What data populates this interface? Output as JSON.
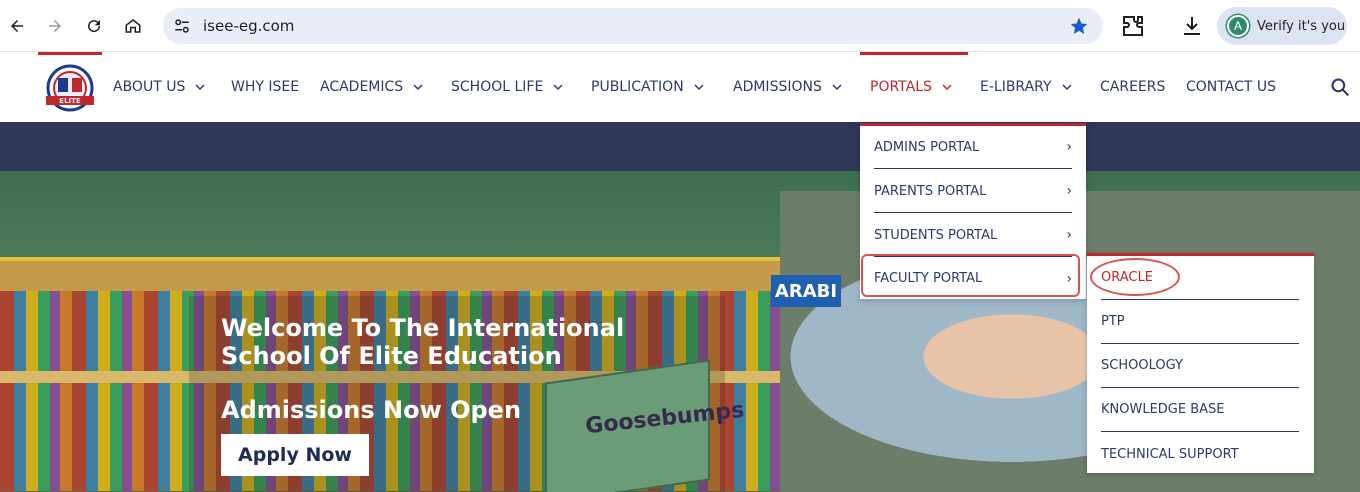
{
  "browser": {
    "url": "isee-eg.com",
    "profile_button": "Verify it's you",
    "profile_initial": "A",
    "icons": [
      "back-icon",
      "forward-icon",
      "reload-icon",
      "home-icon",
      "site-settings-icon",
      "bookmark-star-icon",
      "extensions-icon",
      "download-icon"
    ]
  },
  "nav": {
    "items": [
      {
        "label": "ABOUT US",
        "has_dropdown": true
      },
      {
        "label": "WHY ISEE",
        "has_dropdown": false
      },
      {
        "label": "ACADEMICS",
        "has_dropdown": true
      },
      {
        "label": "SCHOOL LIFE",
        "has_dropdown": true
      },
      {
        "label": "PUBLICATION",
        "has_dropdown": true
      },
      {
        "label": "ADMISSIONS",
        "has_dropdown": true
      },
      {
        "label": "PORTALS",
        "has_dropdown": true,
        "active": true
      },
      {
        "label": "E-LIBRARY",
        "has_dropdown": true
      },
      {
        "label": "CAREERS",
        "has_dropdown": false
      },
      {
        "label": "CONTACT US",
        "has_dropdown": false
      }
    ]
  },
  "portals_menu": {
    "items": [
      {
        "label": "ADMINS PORTAL"
      },
      {
        "label": "PARENTS PORTAL"
      },
      {
        "label": "STUDENTS PORTAL"
      },
      {
        "label": "FACULTY PORTAL",
        "highlighted": true
      }
    ]
  },
  "faculty_submenu": {
    "items": [
      {
        "label": "ORACLE",
        "highlighted": true
      },
      {
        "label": "PTP"
      },
      {
        "label": "SCHOOLOGY"
      },
      {
        "label": "KNOWLEDGE BASE"
      },
      {
        "label": "TECHNICAL SUPPORT"
      }
    ]
  },
  "hero": {
    "title": "Welcome To The International School Of Elite Education",
    "subtitle": "Admissions Now Open",
    "cta": "Apply Now",
    "sign_text": "ARABI",
    "book_title": "Goosebumps"
  },
  "colors": {
    "accent": "#c0272d",
    "nav_text": "#2c3a67",
    "band": "#2f3656"
  }
}
